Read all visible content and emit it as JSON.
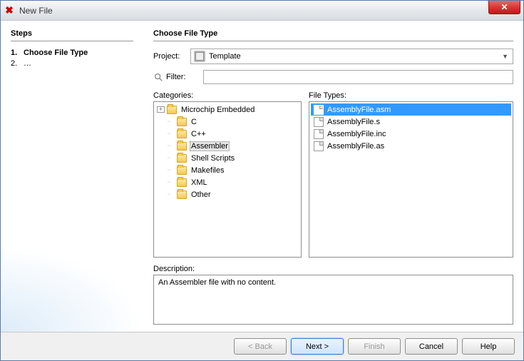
{
  "window": {
    "title": "New File"
  },
  "sidebar": {
    "heading": "Steps",
    "steps": [
      {
        "num": "1.",
        "label": "Choose File Type",
        "active": true
      },
      {
        "num": "2.",
        "label": "…",
        "active": false
      }
    ]
  },
  "main": {
    "heading": "Choose File Type",
    "project_label": "Project:",
    "project_value": "Template",
    "filter_label": "Filter:",
    "filter_value": "",
    "categories_label": "Categories:",
    "filetypes_label": "File Types:",
    "description_label": "Description:",
    "description_text": "An Assembler file with no content."
  },
  "categories": {
    "root": "Microchip Embedded",
    "items": [
      "C",
      "C++",
      "Assembler",
      "Shell Scripts",
      "Makefiles",
      "XML",
      "Other"
    ],
    "selected": "Assembler"
  },
  "filetypes": {
    "items": [
      "AssemblyFile.asm",
      "AssemblyFile.s",
      "AssemblyFile.inc",
      "AssemblyFile.as"
    ],
    "selected": "AssemblyFile.asm"
  },
  "buttons": {
    "back": "< Back",
    "next": "Next >",
    "finish": "Finish",
    "cancel": "Cancel",
    "help": "Help"
  }
}
